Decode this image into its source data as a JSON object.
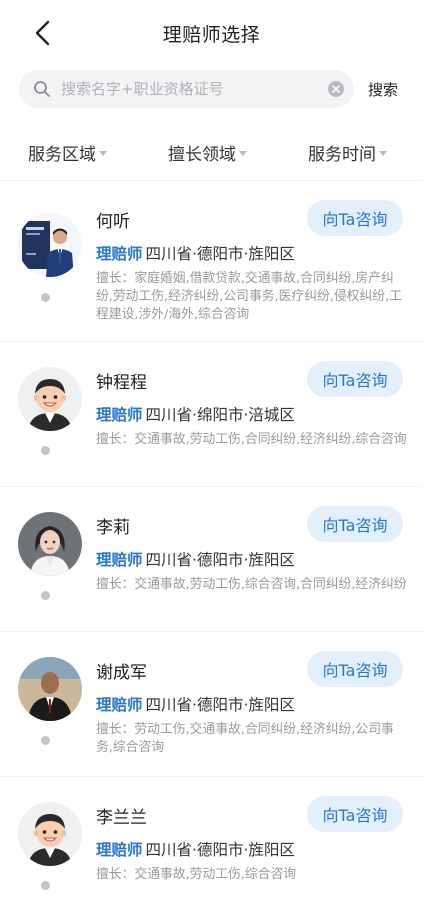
{
  "header": {
    "title": "理赔师选择"
  },
  "search": {
    "placeholder": "搜索名字+职业资格证号",
    "value": "",
    "button_label": "搜索"
  },
  "filters": [
    "服务区域",
    "擅长领域",
    "服务时间"
  ],
  "consult_label": "向Ta咨询",
  "adjusters": [
    {
      "name": "何听",
      "role": "理赔师",
      "region": "四川省·德阳市·旌阳区",
      "skills": "擅长：家庭婚姻,借款贷款,交通事故,合同纠纷,房产纠纷,劳动工伤,经济纠纷,公司事务,医疗纠纷,侵权纠纷,工程建设,涉外/海外,综合咨询"
    },
    {
      "name": "钟程程",
      "role": "理赔师",
      "region": "四川省·绵阳市·涪城区",
      "skills": "擅长：交通事故,劳动工伤,合同纠纷,经济纠纷,综合咨询"
    },
    {
      "name": "李莉",
      "role": "理赔师",
      "region": "四川省·德阳市·旌阳区",
      "skills": "擅长：交通事故,劳动工伤,综合咨询,合同纠纷,经济纠纷"
    },
    {
      "name": "谢成军",
      "role": "理赔师",
      "region": "四川省·德阳市·旌阳区",
      "skills": "擅长：劳动工伤,交通事故,合同纠纷,经济纠纷,公司事务,综合咨询"
    },
    {
      "name": "李兰兰",
      "role": "理赔师",
      "region": "四川省·德阳市·旌阳区",
      "skills": "擅长：交通事故,劳动工伤,综合咨询"
    }
  ]
}
